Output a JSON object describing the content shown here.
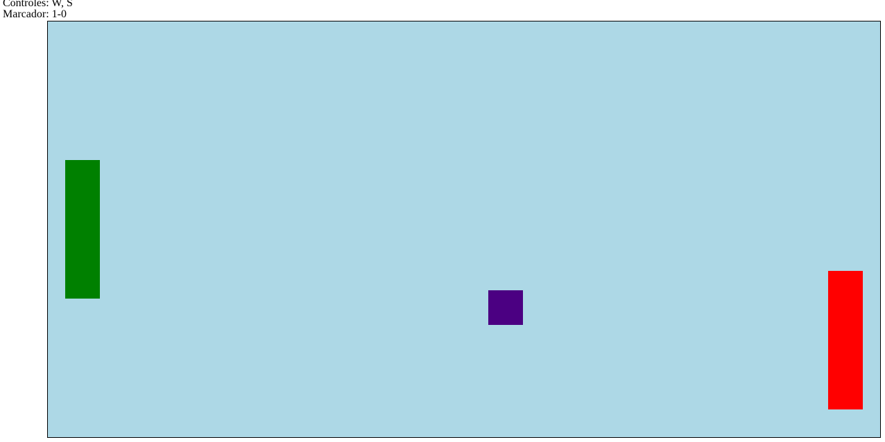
{
  "hud": {
    "controls_label": "Controles",
    "controls_keys": "W, S",
    "score_label": "Marcador",
    "score": "1-0"
  },
  "colors": {
    "arena_background": "#add8e6",
    "arena_border": "#000000",
    "left_paddle": "#008000",
    "right_paddle": "#ff0000",
    "ball": "#4b0082"
  }
}
